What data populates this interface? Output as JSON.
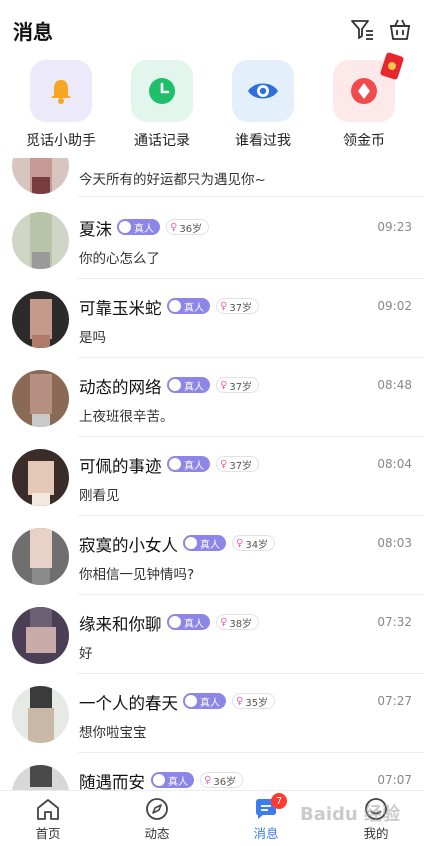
{
  "header": {
    "title": "消息",
    "filter_icon": "filter-icon",
    "basket_icon": "basket-icon"
  },
  "quick": [
    {
      "label": "觅话小助手",
      "icon": "bell-icon",
      "bg": "#ece9fb",
      "fg": "#f5a623"
    },
    {
      "label": "通话记录",
      "icon": "clock-icon",
      "bg": "#e3f6ee",
      "fg": "#1fbf6b"
    },
    {
      "label": "谁看过我",
      "icon": "eye-icon",
      "bg": "#e4effc",
      "fg": "#2f6fe0"
    },
    {
      "label": "领金币",
      "icon": "coin-icon",
      "bg": "#fde9ea",
      "fg": "#f04a4f"
    }
  ],
  "badges": {
    "real": "真人"
  },
  "conversations": [
    {
      "name": "",
      "message": "今天所有的好运都只为遇见你~",
      "time": "",
      "age": ""
    },
    {
      "name": "夏沫",
      "message": "你的心怎么了",
      "time": "09:23",
      "age": "36岁"
    },
    {
      "name": "可靠玉米蛇",
      "message": "是吗",
      "time": "09:02",
      "age": "37岁"
    },
    {
      "name": "动态的网络",
      "message": "上夜班很辛苦。",
      "time": "08:48",
      "age": "37岁"
    },
    {
      "name": "可佩的事迹",
      "message": "刚看见",
      "time": "08:04",
      "age": "37岁"
    },
    {
      "name": "寂寞的小女人",
      "message": "你相信一见钟情吗?",
      "time": "08:03",
      "age": "34岁"
    },
    {
      "name": "缘来和你聊",
      "message": "好",
      "time": "07:32",
      "age": "38岁"
    },
    {
      "name": "一个人的春天",
      "message": "想你啦宝宝",
      "time": "07:27",
      "age": "35岁"
    },
    {
      "name": "随遇而安",
      "message": "",
      "time": "07:07",
      "age": "36岁"
    }
  ],
  "tabs": [
    {
      "label": "首页",
      "icon": "home-icon"
    },
    {
      "label": "动态",
      "icon": "compass-icon"
    },
    {
      "label": "消息",
      "icon": "message-icon",
      "badge": "7"
    },
    {
      "label": "我的",
      "icon": "profile-icon"
    }
  ],
  "watermark": "Baidu 经验"
}
